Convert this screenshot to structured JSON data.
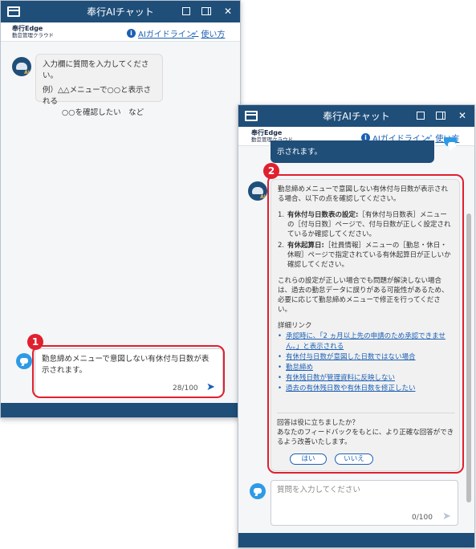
{
  "window1": {
    "title": "奉行AIチャット",
    "logo_line1": "奉行Edge",
    "logo_line2": "勤怠管理クラウド",
    "guideline_link": "AIガイドライン",
    "howto_link": "使い方",
    "bot_intro": "入力欄に質問を入力してください。",
    "bot_example": "例）△△メニューで○○と表示される",
    "bot_example2": "○○を確認したい　など",
    "input_value": "勤怠締めメニューで意図しない有休付与日数が表示されます。",
    "counter": "28/100",
    "badge": "1"
  },
  "window2": {
    "title": "奉行AIチャット",
    "logo_line1": "奉行Edge",
    "logo_line2": "勤怠管理クラウド",
    "guideline_link": "AIガイドライン",
    "howto_link": "使い方",
    "prev_message_tail": "示されます。",
    "badge": "2",
    "answer_intro": "勤怠締めメニューで意図しない有休付与日数が表示される場合、以下の点を確認してください。",
    "points": [
      {
        "num": "1.",
        "head": "有休付与日数表の設定:",
        "body": "［有休付与日数表］メニューの［付与日数］ページで、付与日数が正しく設定されているか確認してください。"
      },
      {
        "num": "2.",
        "head": "有休起算日:",
        "body": "［社員情報］メニューの［勤怠・休日・休暇］ページで指定されている有休起算日が正しいか確認してください。"
      }
    ],
    "answer_note": "これらの設定が正しい場合でも問題が解決しない場合は、過去の勤怠データに誤りがある可能性があるため、必要に応じて勤怠締めメニューで修正を行ってください。",
    "links_title": "詳細リンク",
    "links": [
      "承認時に、「2 ヵ月以上先の申請のため承認できません。」と表示される",
      "有休付与日数が意図した日数ではない場合",
      "勤怠締め",
      "有休残日数が管理資料に反映しない",
      "過去の有休残日数や有休日数を修正したい"
    ],
    "feedback_q": "回答は役に立ちましたか？",
    "feedback_text": "あなたのフィードバックをもとに、より正確な回答ができるよう改善いたします。",
    "yes_label": "はい",
    "no_label": "いいえ",
    "input_placeholder": "質問を入力してください",
    "counter": "0/100"
  },
  "colors": {
    "titlebar": "#1f4e79",
    "accent": "#1a5fb4",
    "highlight": "#e0202e"
  },
  "icons": [
    "window-icon",
    "popout-icon",
    "sidepanel-icon",
    "close-icon",
    "info-icon",
    "help-icon",
    "ai-avatar-icon",
    "user-chat-icon",
    "send-icon"
  ]
}
